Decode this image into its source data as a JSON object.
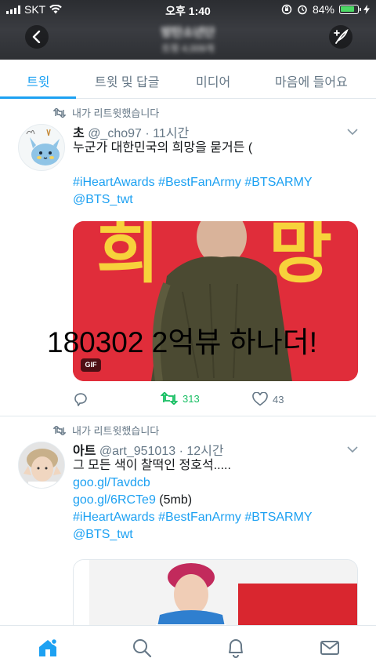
{
  "status_bar": {
    "carrier": "SKT",
    "time": "오후 1:40",
    "battery_percent": "84%",
    "battery_level": 0.84,
    "battery_color": "#4cd964"
  },
  "header": {
    "title": "방탄소년단",
    "subtitle": "트윗 4,009개",
    "back_icon": "chevron-left-icon",
    "compose_icon": "compose-quill-icon"
  },
  "tabs": [
    {
      "label": "트윗",
      "active": true
    },
    {
      "label": "트윗 및 답글",
      "active": false
    },
    {
      "label": "미디어",
      "active": false
    },
    {
      "label": "마음에 들어요",
      "active": false
    }
  ],
  "accent_color": "#1da1f2",
  "tweets": [
    {
      "retweet_label": "내가 리트윗했습니다",
      "name": "초",
      "handle": "@_cho97",
      "time": "· 11시간",
      "text_line": "누군가 대한민국의 희망을 묻거든 (",
      "hashtags": "#iHeartAwards #BestFanArmy #BTSARMY",
      "mention": "@BTS_twt",
      "media_badge": "GIF",
      "media_caption": "180302 2억뷰 하나더!",
      "retweets": "313",
      "likes": "43"
    },
    {
      "retweet_label": "내가 리트윗했습니다",
      "name": "아트",
      "handle": "@art_951013",
      "time": "· 12시간",
      "text_line": "그 모든 색이 찰떡인 정호석.....",
      "link1": "goo.gl/Tavdcb",
      "link2": "goo.gl/6RCTe9",
      "link2_suffix": " (5mb)",
      "hashtags": "#iHeartAwards #BestFanArmy #BTSARMY",
      "mention": "@BTS_twt"
    }
  ],
  "bottom_nav": [
    {
      "icon": "home-icon",
      "active": true
    },
    {
      "icon": "search-icon",
      "active": false
    },
    {
      "icon": "bell-icon",
      "active": false
    },
    {
      "icon": "mail-icon",
      "active": false
    }
  ]
}
